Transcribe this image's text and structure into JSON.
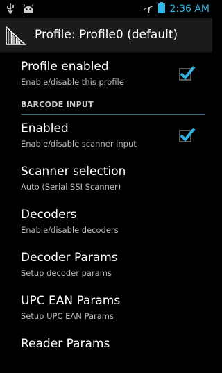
{
  "status_bar": {
    "time": "2:36 AM"
  },
  "action_bar": {
    "title": "Profile: Profile0 (default)"
  },
  "items": [
    {
      "title": "Profile enabled",
      "summary": "Enable/disable this profile",
      "checked": true
    },
    {
      "category": "BARCODE INPUT"
    },
    {
      "title": "Enabled",
      "summary": "Enable/disable scanner input",
      "checked": true
    },
    {
      "title": "Scanner selection",
      "summary": "Auto (Serial SSI Scanner)"
    },
    {
      "title": "Decoders",
      "summary": "Enable/disable decoders"
    },
    {
      "title": "Decoder Params",
      "summary": "Setup decoder params"
    },
    {
      "title": "UPC EAN Params",
      "summary": "Setup UPC EAN Params"
    },
    {
      "title": "Reader Params",
      "summary": ""
    }
  ],
  "colors": {
    "accent": "#33b5e5",
    "background": "#000000"
  }
}
